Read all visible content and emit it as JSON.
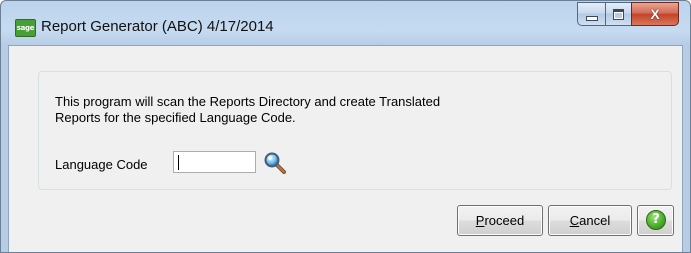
{
  "window": {
    "app_icon_text": "sage",
    "title": "Report Generator (ABC) 4/17/2014",
    "close_glyph": "X"
  },
  "content": {
    "description_line1": "This program will scan the Reports Directory and create Translated",
    "description_line2": "Reports for the specified Language Code.",
    "language_code_label": "Language Code",
    "language_code_value": ""
  },
  "buttons": {
    "proceed_accel": "P",
    "proceed_rest": "roceed",
    "cancel_accel": "C",
    "cancel_rest": "ancel",
    "help_glyph": "?"
  },
  "icons": {
    "lookup": "magnifier-icon",
    "help": "help-icon"
  },
  "colors": {
    "titlebar": "#c6dbf1",
    "close_button": "#c4442a",
    "help_green": "#4cae2c",
    "dialog_bg": "#f0f0f0"
  }
}
